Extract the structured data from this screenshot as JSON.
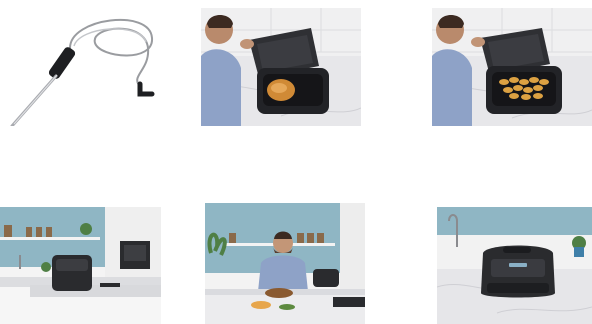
{
  "gallery": {
    "thumbnails": [
      {
        "name": "thermometer-probe",
        "selected": false
      },
      {
        "name": "grill-open-chicken",
        "selected": false
      },
      {
        "name": "grill-open-fries",
        "selected": false
      },
      {
        "name": "kitchen-wide-grill",
        "selected": false
      },
      {
        "name": "chef-cooking-kitchen",
        "selected": false
      },
      {
        "name": "grill-closed-countertop",
        "selected": false
      }
    ]
  },
  "colors": {
    "marble": "#e9e9eb",
    "wall_blue": "#8fb6c4",
    "grill_black": "#2a2b2e",
    "food_gold": "#d79a3c"
  }
}
